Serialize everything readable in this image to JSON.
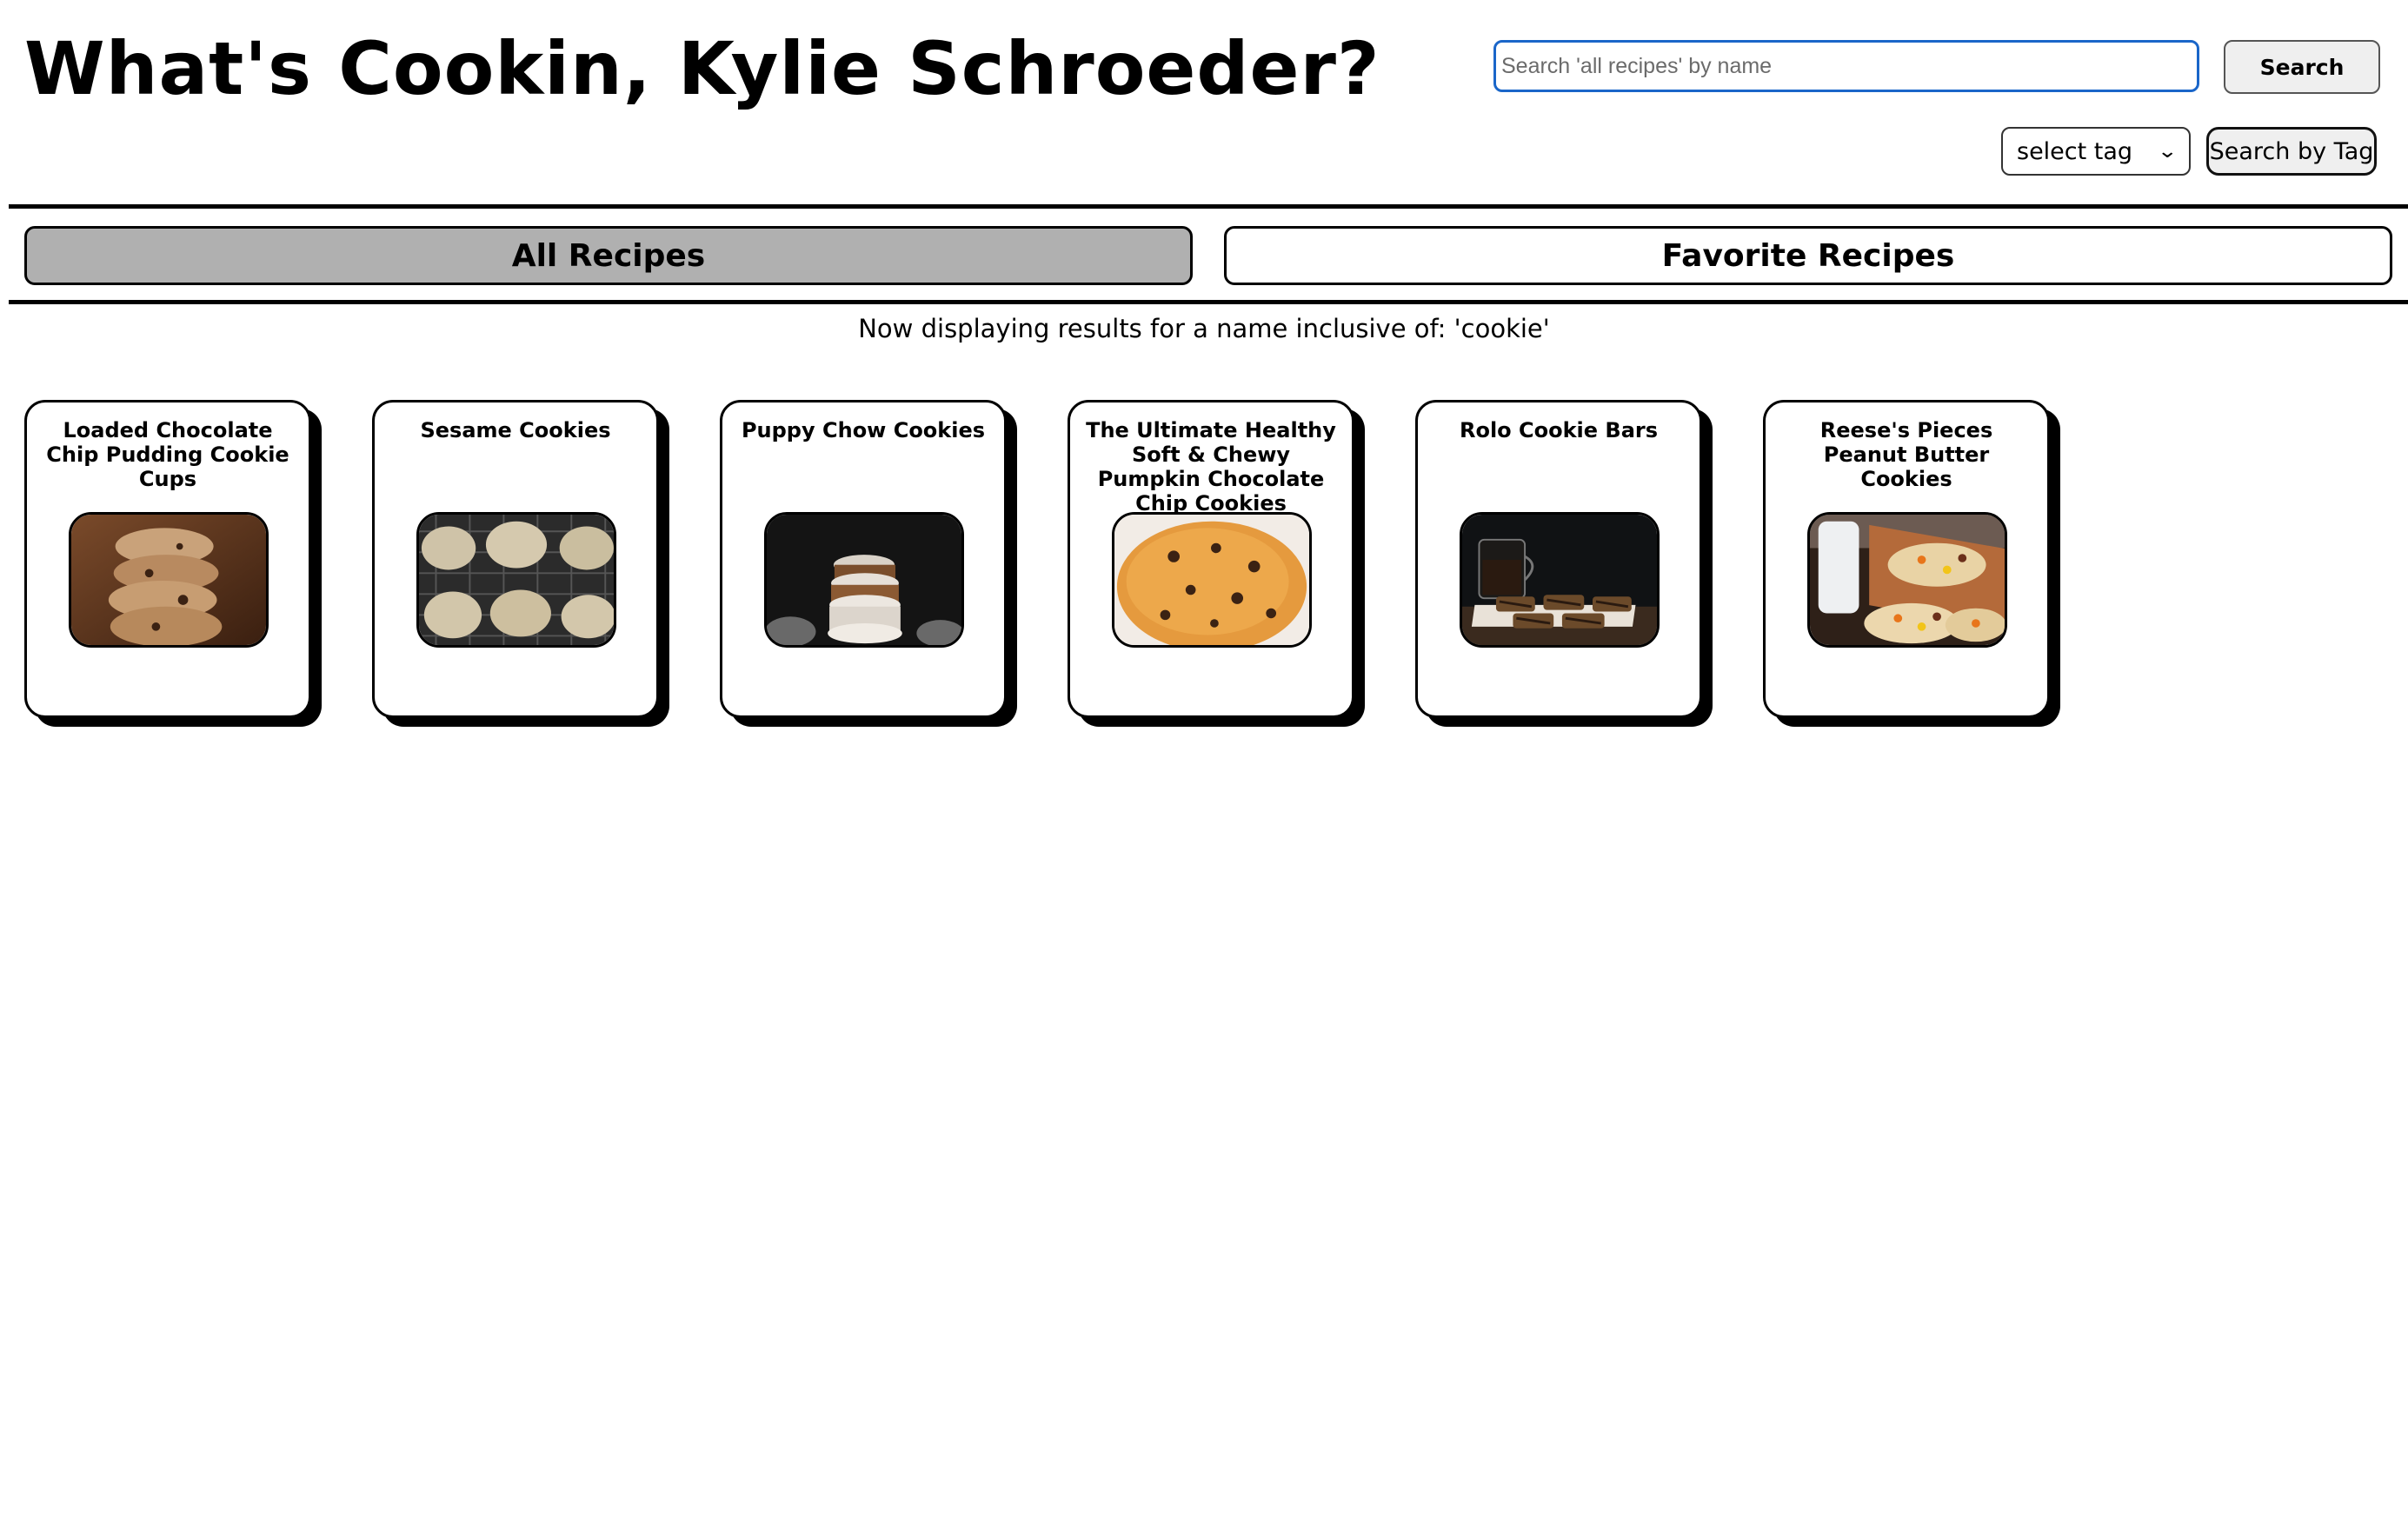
{
  "header": {
    "title": "What's Cookin, Kylie Schroeder?",
    "search_placeholder": "Search 'all recipes' by name",
    "search_button": "Search",
    "tag_select_value": "select tag",
    "tag_button": "Search by Tag"
  },
  "tabs": {
    "all": "All Recipes",
    "favorites": "Favorite Recipes",
    "active": "all"
  },
  "status": "Now displaying results for a name inclusive of: 'cookie'",
  "recipes": [
    {
      "name": "Loaded Chocolate Chip Pudding Cookie Cups"
    },
    {
      "name": "Sesame Cookies"
    },
    {
      "name": "Puppy Chow Cookies"
    },
    {
      "name": "The Ultimate Healthy Soft & Chewy Pumpkin Chocolate Chip Cookies"
    },
    {
      "name": "Rolo Cookie Bars"
    },
    {
      "name": "Reese's Pieces Peanut Butter Cookies"
    }
  ],
  "colors": {
    "active_tab": "#b0b0b0",
    "focus_border": "#1a66c9",
    "text": "#000000"
  }
}
